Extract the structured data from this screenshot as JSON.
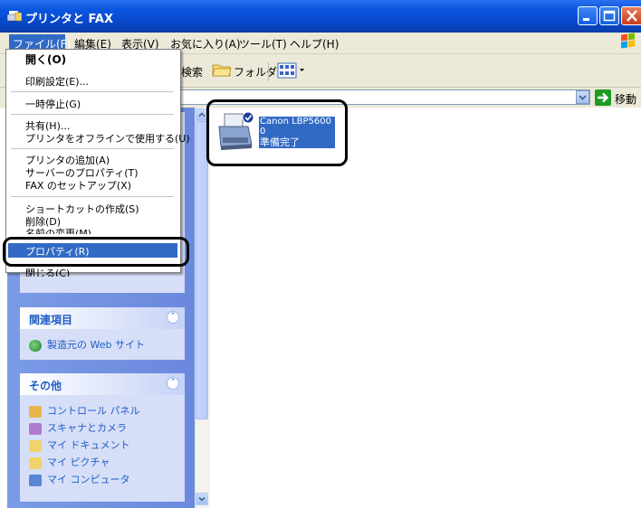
{
  "window": {
    "title": "プリンタと FAX"
  },
  "menubar": {
    "items": [
      "ファイル(F)",
      "編集(E)",
      "表示(V)",
      "お気に入り(A)",
      "ツール(T)",
      "ヘルプ(H)"
    ]
  },
  "toolbar": {
    "search_label": "検索",
    "folders_label": "フォルダ"
  },
  "addressbar": {
    "go_label": "移動"
  },
  "file_menu": {
    "items": [
      "開く(O)",
      "印刷設定(E)...",
      "一時停止(G)",
      "共有(H)...",
      "プリンタをオフラインで使用する(U)",
      "プリンタの追加(A)",
      "サーバーのプロパティ(T)",
      "FAX のセットアップ(X)",
      "ショートカットの作成(S)",
      "削除(D)",
      "名前の変更(M)",
      "プロパティ(R)",
      "閉じる(C)"
    ]
  },
  "printer": {
    "name_line1": "Canon LBP5600",
    "name_line2": "0",
    "status": "準備完了"
  },
  "taskpane": {
    "related": {
      "title": "関連項目",
      "links": [
        "製造元の Web サイト"
      ]
    },
    "other": {
      "title": "その他",
      "links": [
        "コントロール パネル",
        "スキャナとカメラ",
        "マイ ドキュメント",
        "マイ ピクチャ",
        "マイ コンピュータ"
      ]
    }
  },
  "colors": {
    "selection": "#316ac5",
    "titlebar": "#0846c9",
    "taskpane": "#6a88dc",
    "link": "#215dc6"
  }
}
